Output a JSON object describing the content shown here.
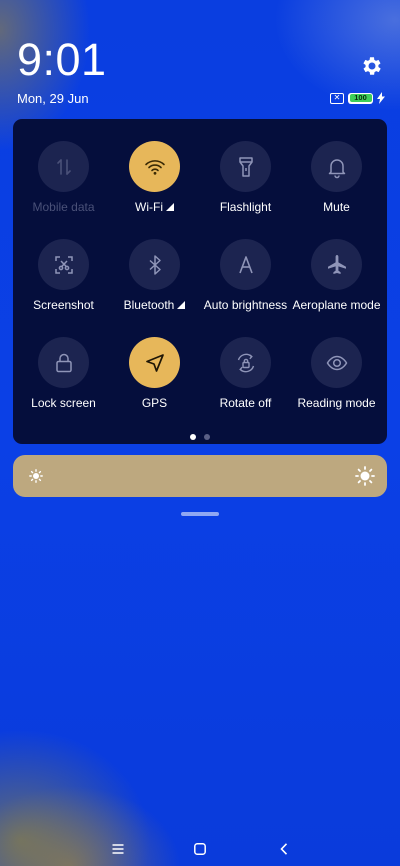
{
  "status": {
    "time": "9:01",
    "date": "Mon, 29 Jun",
    "battery_level": "100",
    "sim_status_icon": "sim-x-icon",
    "charging_icon": "bolt-icon"
  },
  "quick_settings": {
    "tiles": [
      {
        "label": "Mobile data",
        "icon": "mobile-data-icon",
        "active": false,
        "disabled": true,
        "signal": false
      },
      {
        "label": "Wi-Fi",
        "icon": "wifi-icon",
        "active": true,
        "disabled": false,
        "signal": true
      },
      {
        "label": "Flashlight",
        "icon": "flashlight-icon",
        "active": false,
        "disabled": false,
        "signal": false
      },
      {
        "label": "Mute",
        "icon": "bell-icon",
        "active": false,
        "disabled": false,
        "signal": false
      },
      {
        "label": "Screenshot",
        "icon": "screenshot-icon",
        "active": false,
        "disabled": false,
        "signal": false
      },
      {
        "label": "Bluetooth",
        "icon": "bluetooth-icon",
        "active": false,
        "disabled": false,
        "signal": true
      },
      {
        "label": "Auto brightness",
        "icon": "auto-brightness-icon",
        "active": false,
        "disabled": false,
        "signal": false
      },
      {
        "label": "Aeroplane mode",
        "icon": "airplane-icon",
        "active": false,
        "disabled": false,
        "signal": false
      },
      {
        "label": "Lock screen",
        "icon": "lock-icon",
        "active": false,
        "disabled": false,
        "signal": false
      },
      {
        "label": "GPS",
        "icon": "location-arrow-icon",
        "active": true,
        "disabled": false,
        "signal": false
      },
      {
        "label": "Rotate off",
        "icon": "rotation-lock-icon",
        "active": false,
        "disabled": false,
        "signal": false
      },
      {
        "label": "Reading mode",
        "icon": "eye-icon",
        "active": false,
        "disabled": false,
        "signal": false
      }
    ],
    "page_count": 2,
    "current_page": 1
  },
  "brightness": {
    "min_icon": "sun-small-icon",
    "max_icon": "sun-large-icon"
  },
  "navigation": {
    "buttons": [
      "menu-icon",
      "home-icon",
      "back-icon"
    ]
  },
  "colors": {
    "background": "#0b40e6",
    "panel": "#050e3c",
    "tile_off": "#1c2450",
    "tile_on": "#e7b75a",
    "brightness_bar": "#bda87f",
    "battery_fill": "#3ecf5a"
  }
}
